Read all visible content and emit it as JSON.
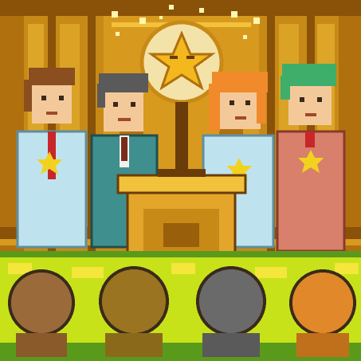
{
  "scene": {
    "title": "",
    "palette": {
      "wall_gold": "#d89a1e",
      "wall_dark": "#8a5208",
      "wall_light": "#f2c23a",
      "floor_green": "#c8e21a",
      "floor_yellow": "#f4e63a",
      "podium_gold": "#e3a52a",
      "podium_dark": "#9a5f0b",
      "clock_face": "#f4e3a8",
      "star_gold": "#f2b81e",
      "suit_lightblue": "#bfe3ee",
      "suit_teal": "#3f8f8f",
      "suit_salmon": "#d8806b",
      "hair_brown": "#8a4e1f",
      "hair_gray": "#5a5a5a",
      "hair_orange": "#f08a2a",
      "hair_green": "#3fae6a",
      "skin": "#f4c99a",
      "tie_red": "#c8262a"
    },
    "characters": [
      {
        "id": "char-1",
        "hair": "brown",
        "suit": "light-blue",
        "badge": "gold-star"
      },
      {
        "id": "char-2",
        "hair": "gray",
        "suit": "teal",
        "badge": "none"
      },
      {
        "id": "char-3",
        "hair": "orange",
        "suit": "light-blue",
        "badge": "gold-star"
      },
      {
        "id": "char-4",
        "hair": "green",
        "suit": "salmon",
        "badge": "gold-star"
      }
    ],
    "audience": [
      {
        "id": "head-1",
        "hair_color": "#9a6a3a"
      },
      {
        "id": "head-2",
        "hair_color": "#9a7420"
      },
      {
        "id": "head-3",
        "hair_color": "#6a6a6a"
      },
      {
        "id": "head-4",
        "hair_color": "#e0882a"
      }
    ]
  }
}
